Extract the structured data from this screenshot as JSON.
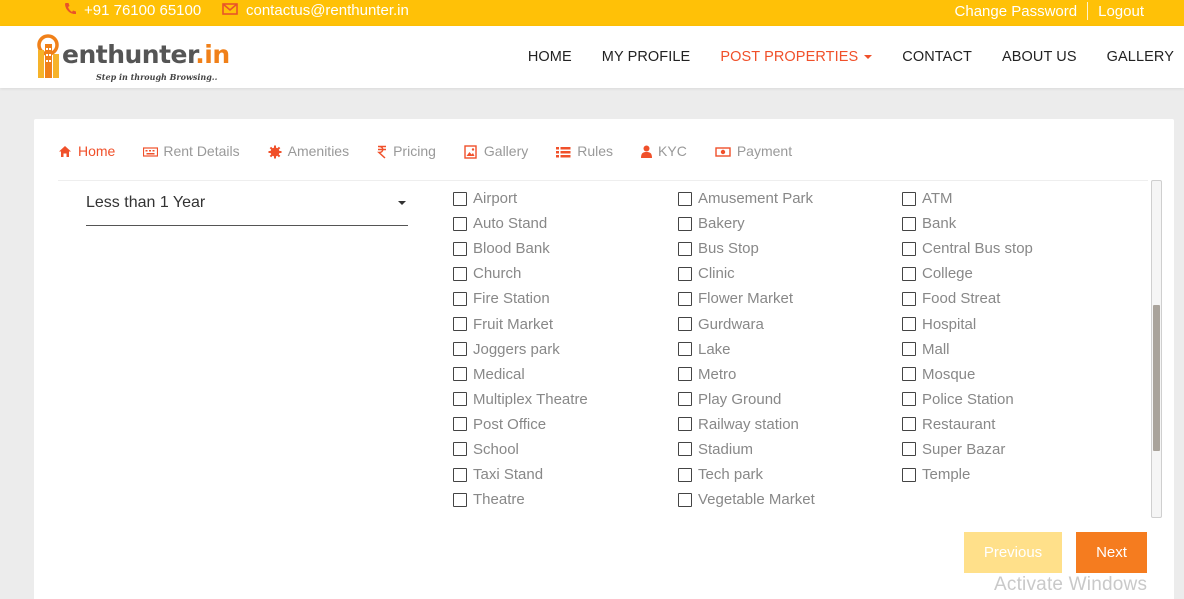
{
  "topbar": {
    "phone": "+91 76100 65100",
    "email": "contactus@renthunter.in",
    "change_password": "Change Password",
    "logout": "Logout"
  },
  "logo": {
    "brand_main": "enthunter",
    "brand_tld": ".in",
    "tagline": "Step in through Browsing.."
  },
  "nav": {
    "items": [
      "HOME",
      "MY PROFILE",
      "POST PROPERTIES",
      "CONTACT",
      "ABOUT US",
      "GALLERY"
    ],
    "active_index": 2
  },
  "tabs": [
    {
      "label": "Home",
      "icon": "home-icon"
    },
    {
      "label": "Rent Details",
      "icon": "keyboard-icon"
    },
    {
      "label": "Amenities",
      "icon": "gear-icon"
    },
    {
      "label": "Pricing",
      "icon": "rupee-icon"
    },
    {
      "label": "Gallery",
      "icon": "image-icon"
    },
    {
      "label": "Rules",
      "icon": "list-icon"
    },
    {
      "label": "KYC",
      "icon": "user-icon"
    },
    {
      "label": "Payment",
      "icon": "money-icon"
    }
  ],
  "age_select": {
    "value": "Less than 1 Year"
  },
  "amenities": {
    "col1": [
      "Airport",
      "Auto Stand",
      "Blood Bank",
      "Church",
      "Fire Station",
      "Fruit Market",
      "Joggers park",
      "Medical",
      "Multiplex Theatre",
      "Post Office",
      "School",
      "Taxi Stand",
      "Theatre"
    ],
    "col2": [
      "Amusement Park",
      "Bakery",
      "Bus Stop",
      "Clinic",
      "Flower Market",
      "Gurdwara",
      "Lake",
      "Metro",
      "Play Ground",
      "Railway station",
      "Stadium",
      "Tech park",
      "Vegetable Market"
    ],
    "col3": [
      "ATM",
      "Bank",
      "Central Bus stop",
      "College",
      "Food Streat",
      "Hospital",
      "Mall",
      "Mosque",
      "Police Station",
      "Restaurant",
      "Super Bazar",
      "Temple"
    ]
  },
  "buttons": {
    "previous": "Previous",
    "next": "Next"
  },
  "watermark": "Activate Windows",
  "colors": {
    "accent": "#f0502a",
    "topbar": "#ffc107",
    "next": "#f57c1f",
    "previous": "#ffe08a"
  }
}
